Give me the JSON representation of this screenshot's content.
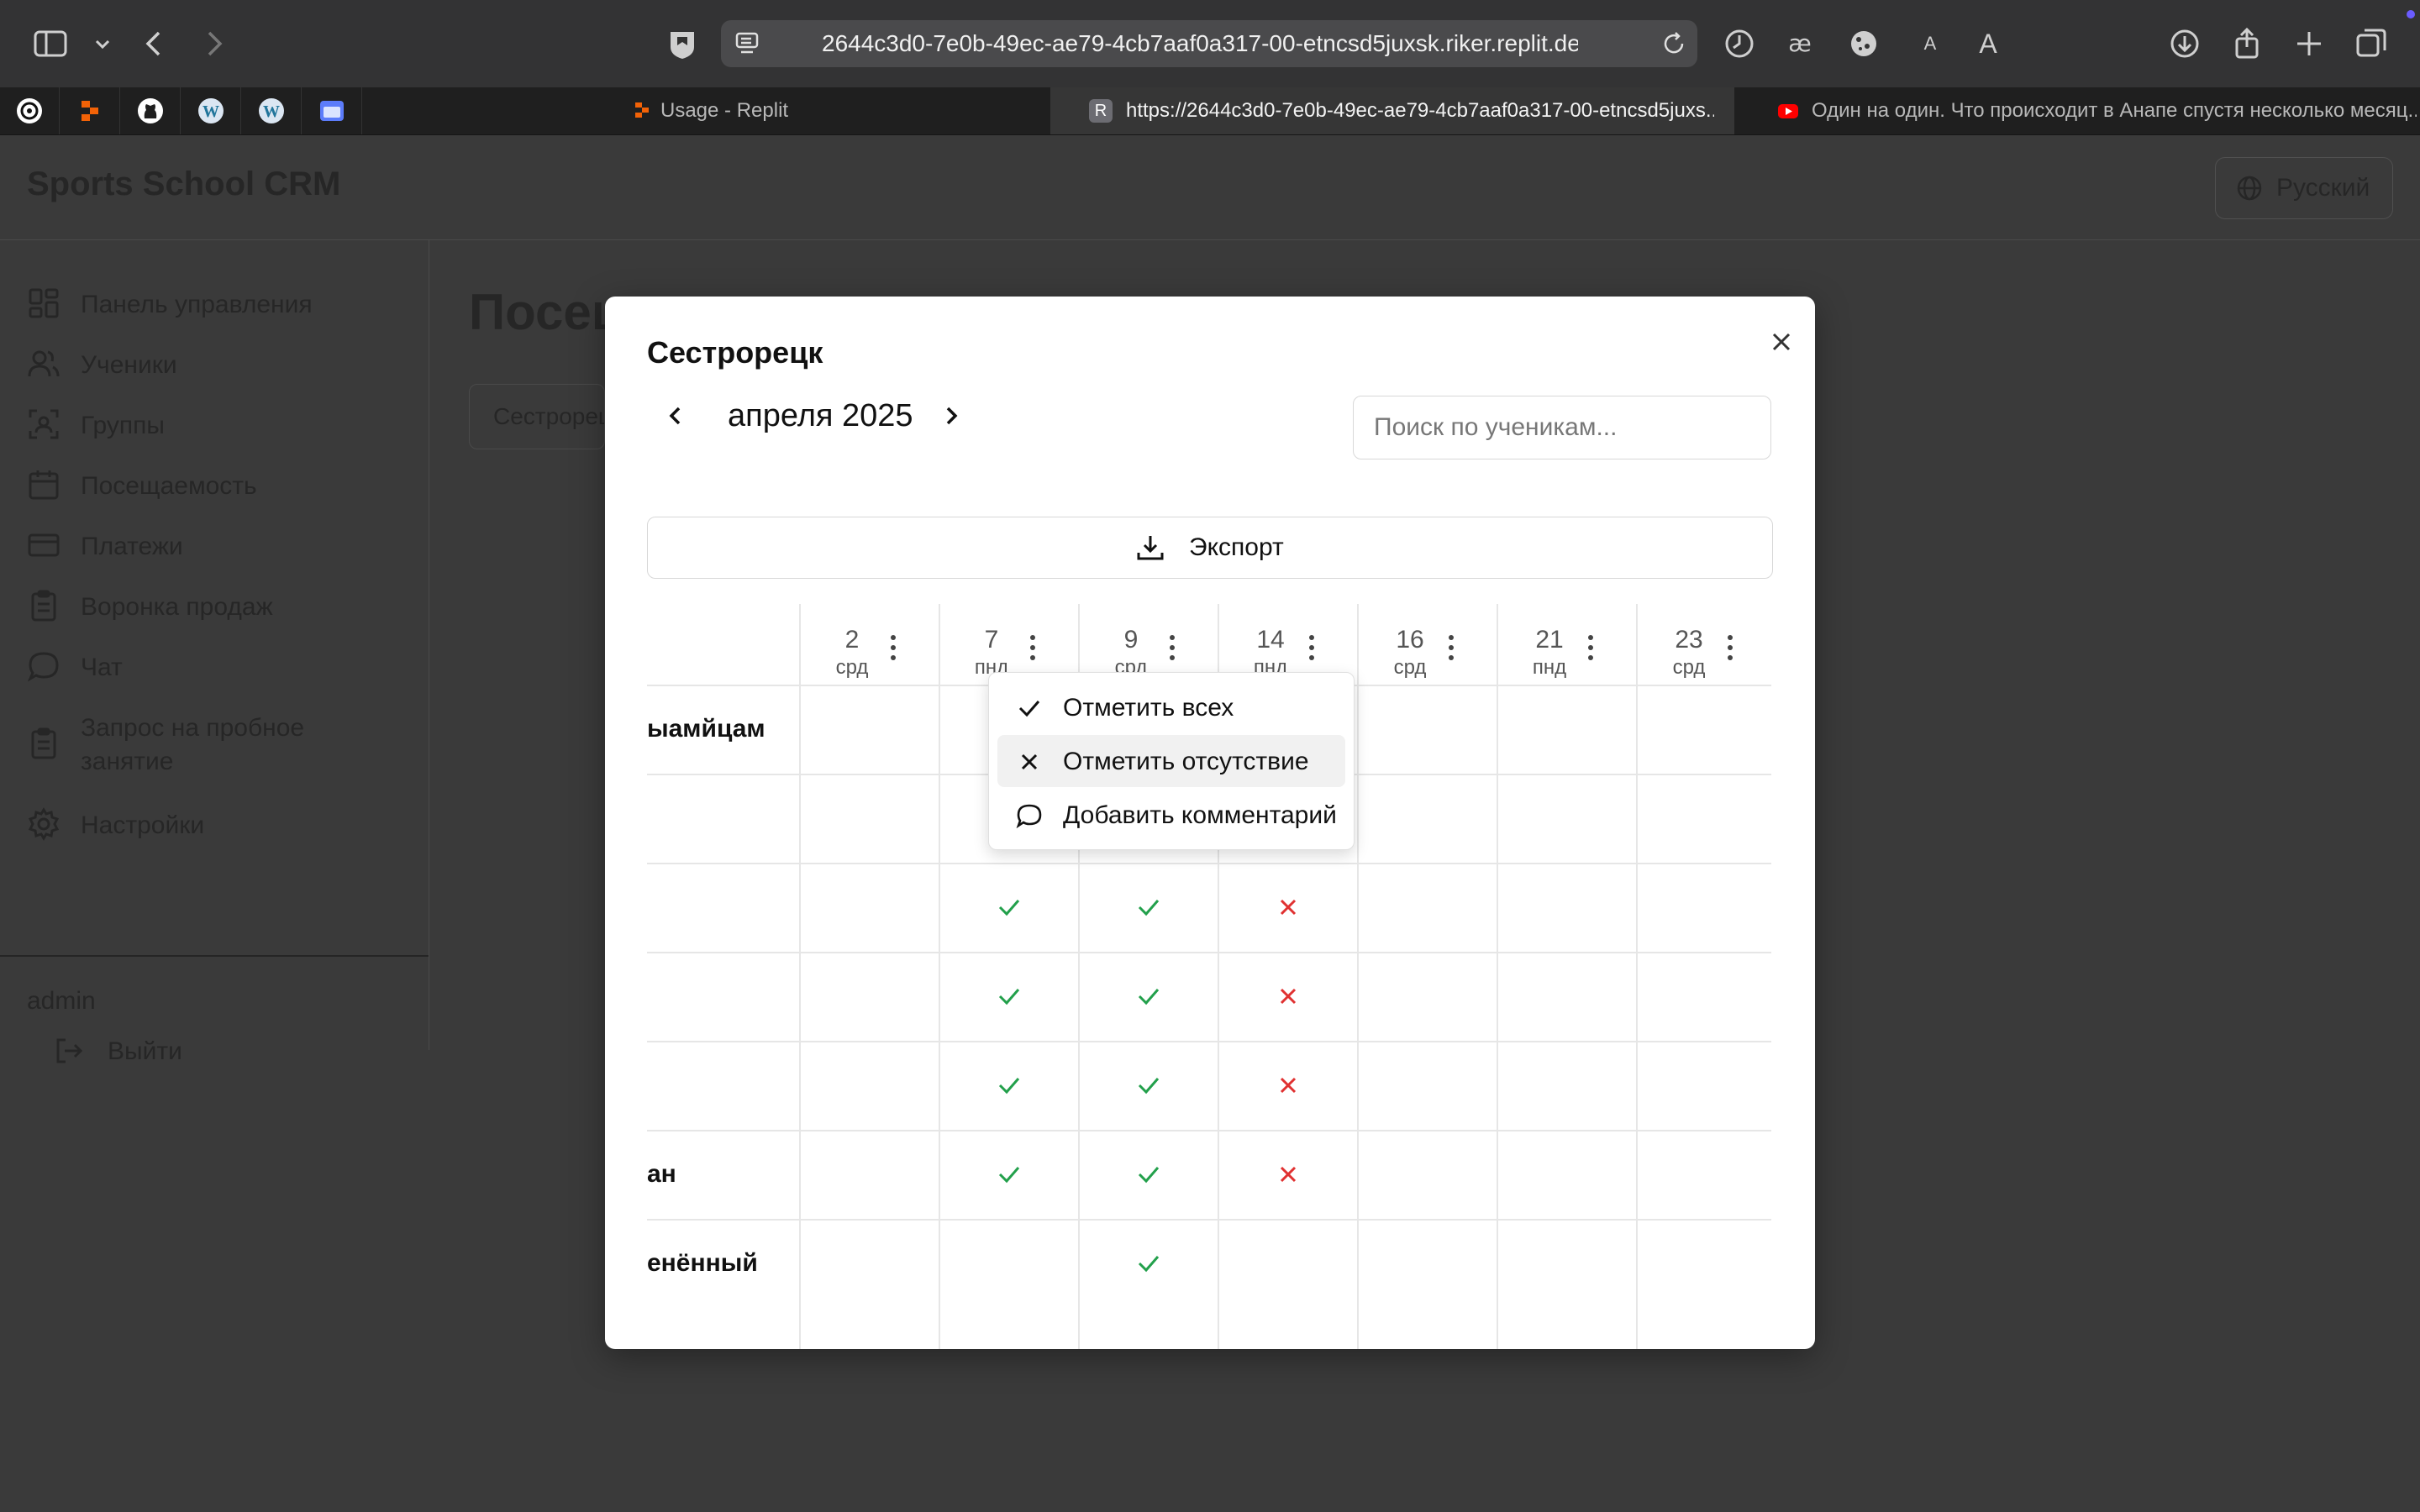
{
  "browser": {
    "url": "2644c3d0-7e0b-49ec-ae79-4cb7aaf0a317-00-etncsd5juxsk.riker.replit.dev",
    "reader_small": "A",
    "reader_large": "A",
    "tabs": [
      {
        "title": "Usage - Replit"
      },
      {
        "title": "https://2644c3d0-7e0b-49ec-ae79-4cb7aaf0a317-00-etncsd5juxs..."
      },
      {
        "title": "Один на один. Что происходит в Анапе спустя несколько месяц..."
      }
    ]
  },
  "app": {
    "brand": "Sports School CRM",
    "language": "Русский",
    "page_title": "Посещаемость",
    "group_select": "Сестрорецк",
    "nav": [
      {
        "label": "Панель управления"
      },
      {
        "label": "Ученики"
      },
      {
        "label": "Группы"
      },
      {
        "label": "Посещаемость"
      },
      {
        "label": "Платежи"
      },
      {
        "label": "Воронка продаж"
      },
      {
        "label": "Чат"
      },
      {
        "label": "Запрос на пробное занятие"
      },
      {
        "label": "Настройки"
      }
    ],
    "user": "admin",
    "logout": "Выйти"
  },
  "modal": {
    "title": "Сестрорецк",
    "month": "апреля 2025",
    "search_placeholder": "Поиск по ученикам...",
    "export_label": "Экспорт",
    "columns": [
      {
        "day": "2",
        "weekday": "срд"
      },
      {
        "day": "7",
        "weekday": "пнд"
      },
      {
        "day": "9",
        "weekday": "срд"
      },
      {
        "day": "14",
        "weekday": "пнд"
      },
      {
        "day": "16",
        "weekday": "срд"
      },
      {
        "day": "21",
        "weekday": "пнд"
      },
      {
        "day": "23",
        "weekday": "срд"
      }
    ],
    "rows": [
      {
        "name": "ыамйцам",
        "marks": [
          "",
          "",
          "",
          "",
          "",
          "",
          ""
        ]
      },
      {
        "name": "",
        "marks": [
          "",
          "",
          "",
          "",
          "",
          "",
          ""
        ]
      },
      {
        "name": "",
        "marks": [
          "",
          "present",
          "present",
          "absent",
          "",
          "",
          ""
        ]
      },
      {
        "name": "",
        "marks": [
          "",
          "present",
          "present",
          "absent",
          "",
          "",
          ""
        ]
      },
      {
        "name": "",
        "marks": [
          "",
          "present",
          "present",
          "absent",
          "",
          "",
          ""
        ]
      },
      {
        "name": "ан",
        "marks": [
          "",
          "present",
          "present",
          "absent",
          "",
          "",
          ""
        ]
      },
      {
        "name": "енённый",
        "marks": [
          "",
          "",
          "present",
          "",
          "",
          "",
          ""
        ]
      }
    ],
    "menu": [
      {
        "label": "Отметить всех",
        "icon": "check-icon"
      },
      {
        "label": "Отметить отсутствие",
        "icon": "x-icon"
      },
      {
        "label": "Добавить комментарий",
        "icon": "comment-icon"
      }
    ]
  },
  "colors": {
    "present": "#22a04b",
    "absent": "#e03131",
    "overlay_bg": "#3a3a3a"
  }
}
